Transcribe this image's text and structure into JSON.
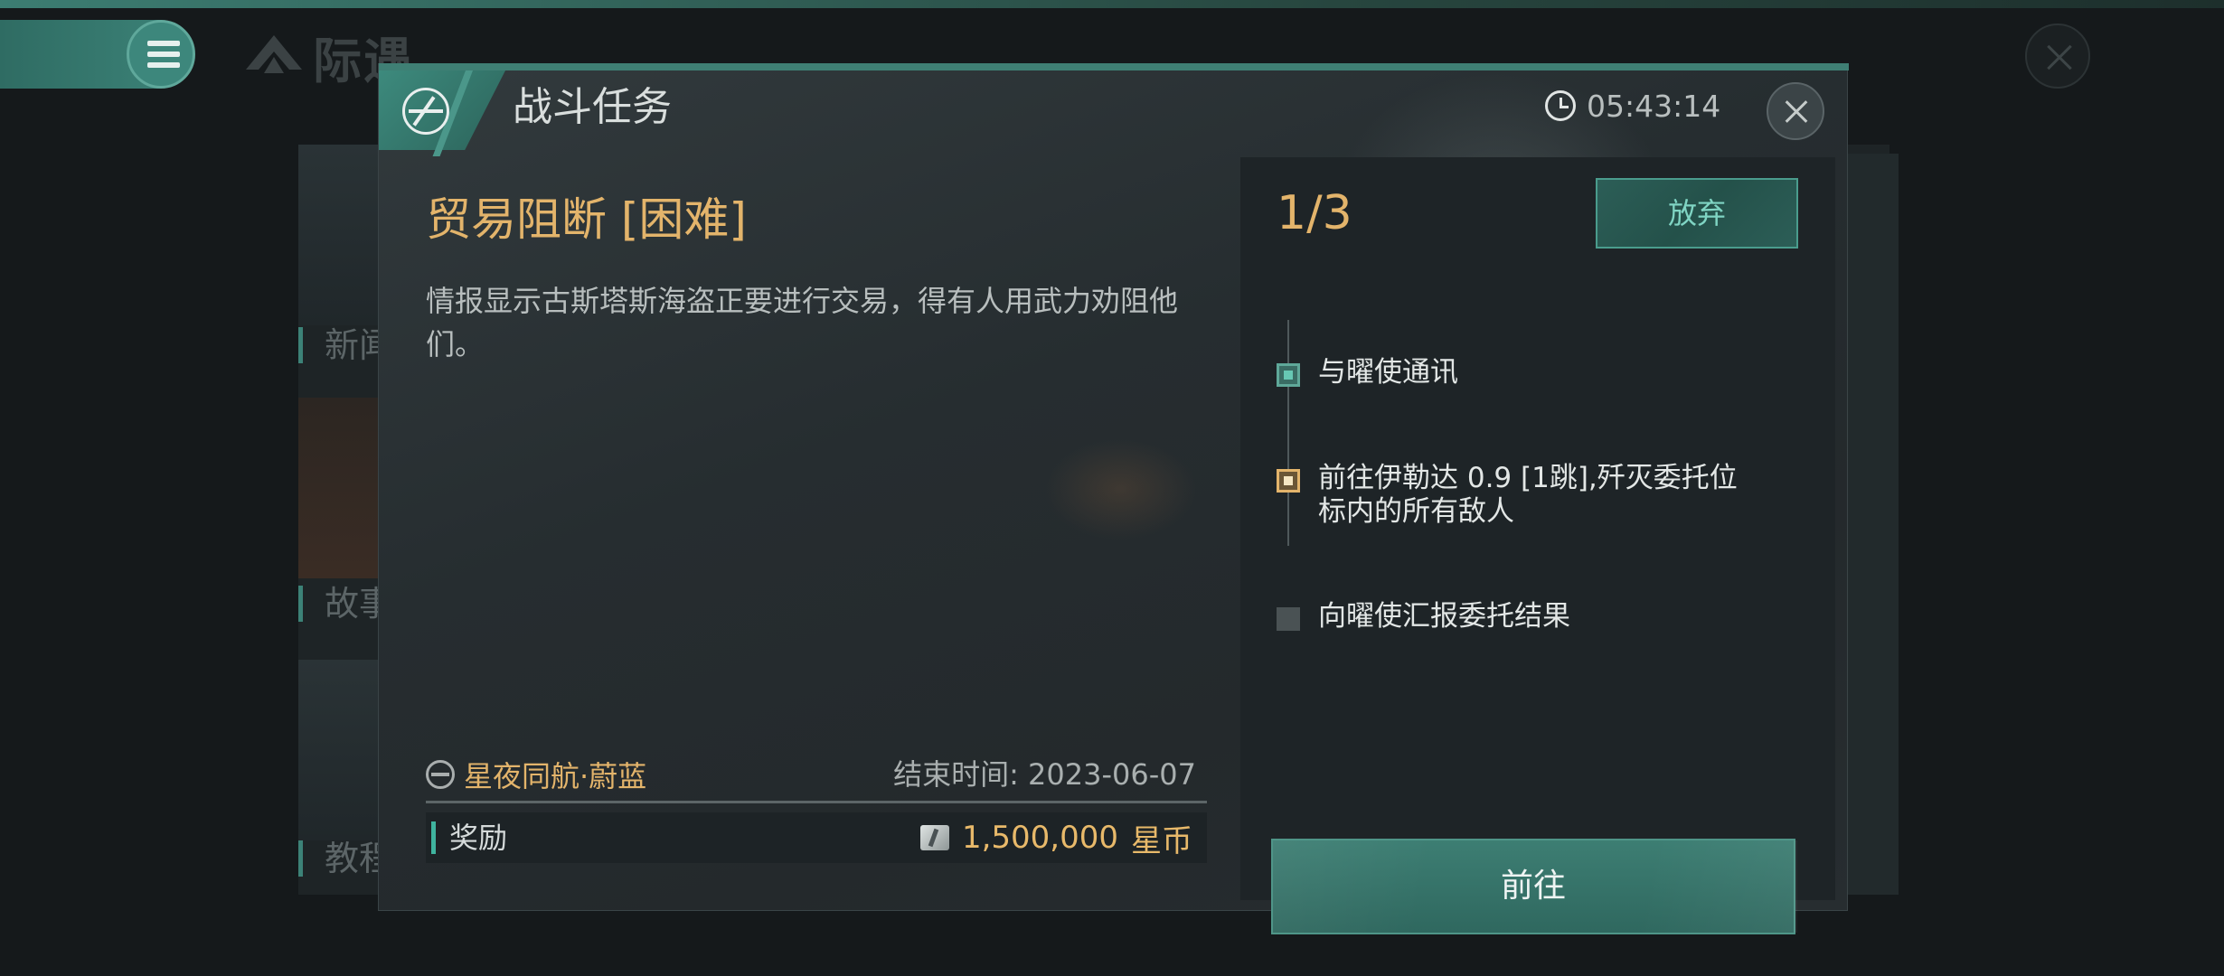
{
  "background": {
    "app_logo_text": "际遇",
    "side_labels": [
      "新闻",
      "故事",
      "教程"
    ]
  },
  "dialog": {
    "title": "战斗任务",
    "timer": "05:43:14",
    "mission": {
      "name": "贸易阻断 [困难]",
      "description": "情报显示古斯塔斯海盗正要进行交易，得有人用武力劝阻他们。",
      "issuer": "星夜同航·蔚蓝",
      "end_time": "结束时间: 2023-06-07",
      "reward_label": "奖励",
      "reward_amount": "1,500,000",
      "reward_currency": "星币"
    },
    "progress": "1/3",
    "abandon_label": "放弃",
    "steps": [
      {
        "text": "与曜使通讯",
        "status": "done"
      },
      {
        "text": "前往伊勒达 0.9 [1跳],歼灭委托位标内的所有敌人",
        "status": "active"
      },
      {
        "text": "向曜使汇报委托结果",
        "status": "pending"
      }
    ],
    "go_label": "前往"
  },
  "colors": {
    "accent_teal": "#3f7f74",
    "gold": "#e3b46b"
  },
  "icons": [
    "menu-icon",
    "app-logo-icon",
    "mission-type-icon",
    "clock-icon",
    "close-icon",
    "faction-icon",
    "currency-icon"
  ]
}
